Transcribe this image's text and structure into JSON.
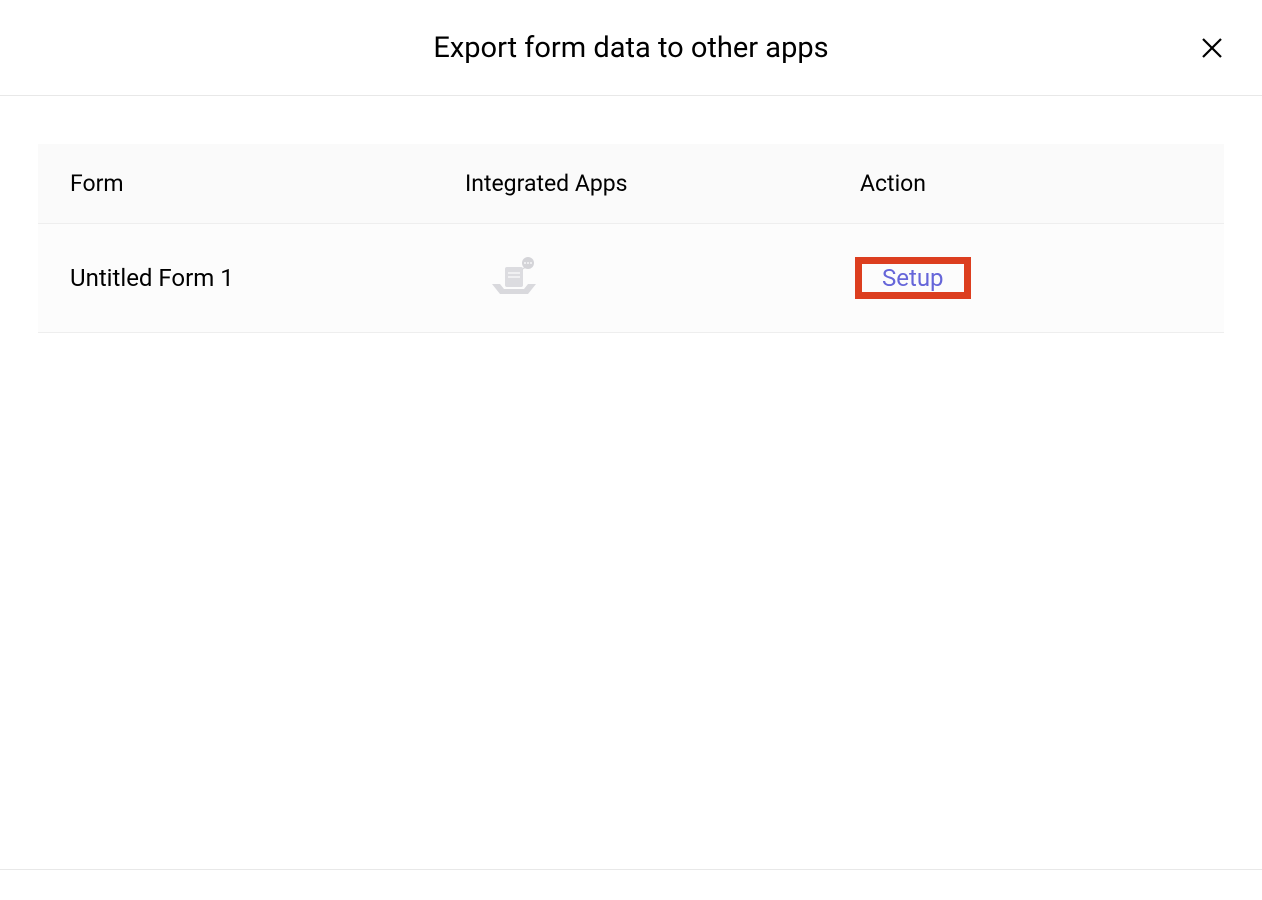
{
  "header": {
    "title": "Export form data to other apps"
  },
  "table": {
    "columns": {
      "form": "Form",
      "apps": "Integrated Apps",
      "action": "Action"
    },
    "rows": [
      {
        "form": "Untitled Form 1",
        "action": "Setup"
      }
    ]
  }
}
